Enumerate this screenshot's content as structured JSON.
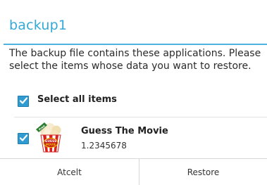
{
  "dialog": {
    "title": "backup1",
    "message": "The backup file contains these applications. Please select the items whose data you want to restore.",
    "accent_color": "#33a9d8"
  },
  "select_all": {
    "label": "Select all items",
    "checked": true
  },
  "apps": [
    {
      "name": "Guess The Movie",
      "version": "1.2345678",
      "checked": true,
      "icon": "guess-the-movie-app-icon"
    }
  ],
  "buttons": {
    "left_label": "Atcelt",
    "right_label": "Restore"
  }
}
